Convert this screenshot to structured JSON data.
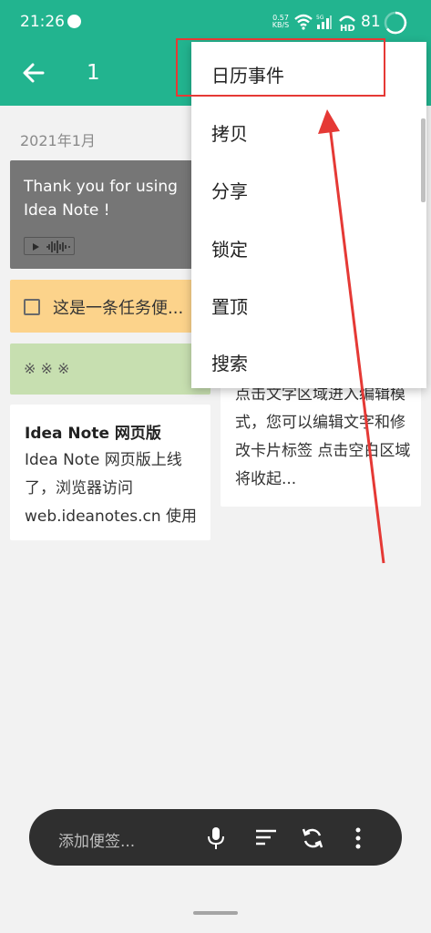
{
  "status": {
    "time": "21:26",
    "net_speed_value": "0.57",
    "net_speed_unit": "KB/S",
    "signal_label": "5G",
    "hd_label": "HD",
    "battery": "81"
  },
  "appbar": {
    "title": "1"
  },
  "date_header": "2021年1月",
  "notes": {
    "welcome": "Thank you for using Idea Note !",
    "task": "这是一条任务便...",
    "stars": "※ ※ ※",
    "web_title": "Idea Note 网页版",
    "web_body": "Idea Note 网页版上线了，浏览器访问 web.ideanotes.cn 使用",
    "tip_body": "点击文字区域进入编辑模式，您可以编辑文字和修改卡片标签 点击空白区域将收起..."
  },
  "menu": {
    "items": [
      "日历事件",
      "拷贝",
      "分享",
      "锁定",
      "置顶",
      "搜索"
    ]
  },
  "bottom": {
    "placeholder": "添加便签..."
  },
  "colors": {
    "primary": "#22b48f",
    "gray_note": "#767676",
    "task_note": "#fcd38b",
    "green_note": "#c7dfb0",
    "annotation_red": "#e53935",
    "bottom_bar": "#2f2f2f"
  },
  "icons": [
    "chat-bubble-icon",
    "wifi-icon",
    "signal-icon",
    "hd-call-icon",
    "battery-ring-icon",
    "back-arrow-icon",
    "play-icon",
    "waveform-icon",
    "microphone-icon",
    "sort-icon",
    "sync-icon",
    "more-vert-icon"
  ]
}
